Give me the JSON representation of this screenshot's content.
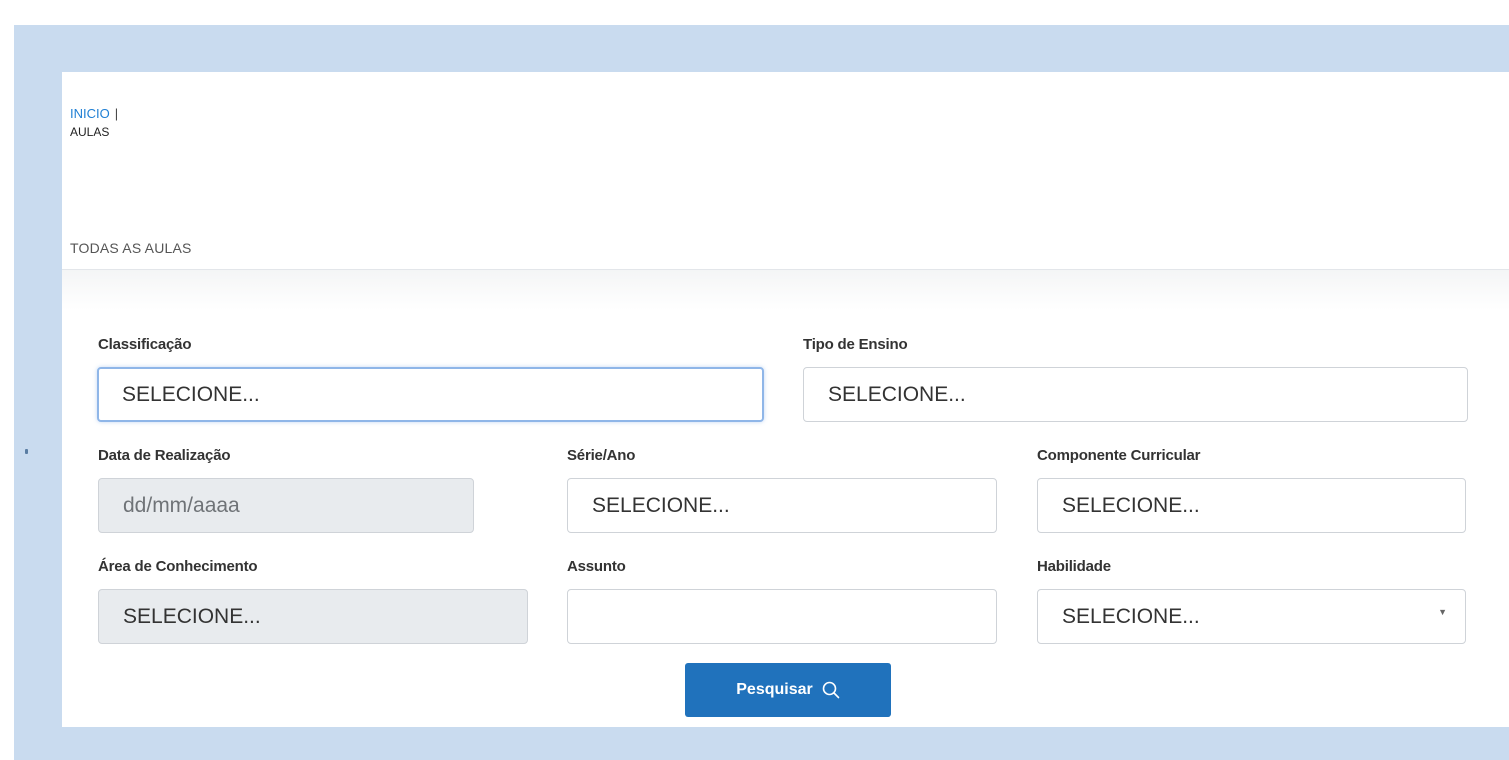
{
  "breadcrumb": {
    "home": "INICIO",
    "separator": "|",
    "current": "AULAS"
  },
  "section_title": "TODAS AS AULAS",
  "filters": {
    "classificacao": {
      "label": "Classificação",
      "value": "SELECIONE..."
    },
    "tipo_ensino": {
      "label": "Tipo de Ensino",
      "value": "SELECIONE..."
    },
    "data_realizacao": {
      "label": "Data de Realização",
      "placeholder": "dd/mm/aaaa"
    },
    "serie_ano": {
      "label": "Série/Ano",
      "value": "SELECIONE..."
    },
    "componente_curricular": {
      "label": "Componente Curricular",
      "value": "SELECIONE..."
    },
    "area_conhecimento": {
      "label": "Área de Conhecimento",
      "value": "SELECIONE..."
    },
    "assunto": {
      "label": "Assunto",
      "value": ""
    },
    "habilidade": {
      "label": "Habilidade",
      "value": "SELECIONE..."
    }
  },
  "search_button": {
    "label": "Pesquisar",
    "icon": "search-icon",
    "color": "#2072bc"
  },
  "colors": {
    "page_background": "#c9dbef",
    "link": "#1f7fd4",
    "focus_border": "#8fb6e8",
    "disabled_field": "#e8ebee"
  }
}
